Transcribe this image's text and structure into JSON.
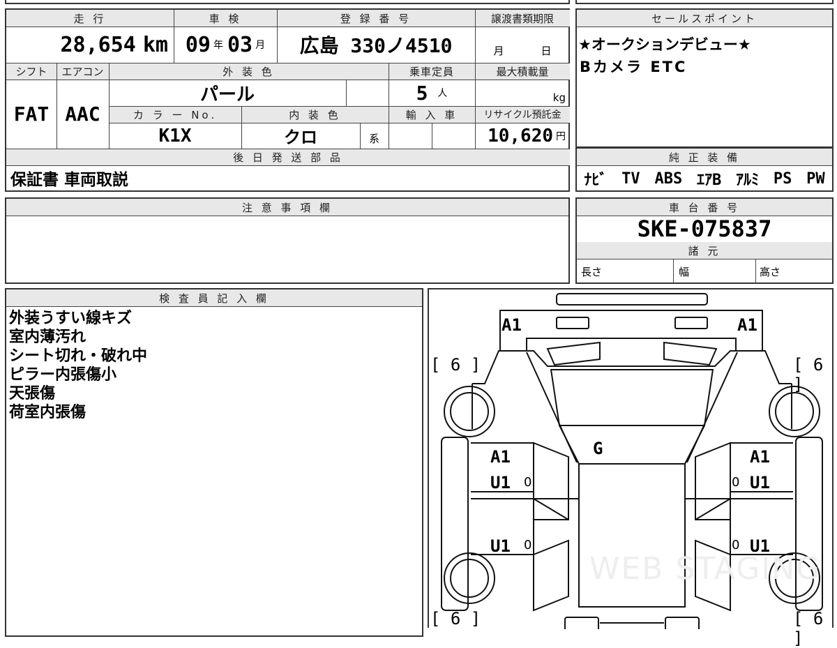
{
  "mileage": {
    "label": "走 行",
    "value": "28,654",
    "unit": "km"
  },
  "inspection": {
    "label": "車 検",
    "year": "09",
    "year_unit": "年",
    "month": "03",
    "month_unit": "月"
  },
  "registration": {
    "label": "登 録 番 号",
    "value": "広島 330ノ4510"
  },
  "transfer_deadline": {
    "label": "譲渡書類期限",
    "month_unit": "月",
    "day_unit": "日"
  },
  "shift": {
    "label": "シフト",
    "value": "FAT"
  },
  "aircon": {
    "label": "エアコン",
    "value": "AAC"
  },
  "exterior_color": {
    "label": "外 装 色",
    "value": "パール"
  },
  "capacity": {
    "label": "乗車定員",
    "value": "5",
    "unit": "人"
  },
  "max_load": {
    "label": "最大積載量",
    "unit": "kg"
  },
  "color_no": {
    "label": "カ ラ ー No.",
    "value": "K1X"
  },
  "interior_color": {
    "label": "内 装 色",
    "value": "クロ",
    "suffix": "系"
  },
  "import": {
    "label": "輸 入 車"
  },
  "recycle": {
    "label": "リサイクル預託金",
    "value": "10,620",
    "unit": "円"
  },
  "later_parts": {
    "label": "後 日 発 送 部 品",
    "value": "保証書 車両取説"
  },
  "sales_point": {
    "label": "セールスポイント",
    "lines": [
      "★オークションデビュー★",
      "Bカメラ ETC"
    ]
  },
  "equipment": {
    "label": "純 正 装 備",
    "items": [
      "ﾅﾋﾞ",
      "TV",
      "ABS",
      "ｴｱB",
      "ｱﾙﾐ",
      "PS",
      "PW"
    ]
  },
  "notes": {
    "label": "注 意 事 項 欄"
  },
  "chassis": {
    "label": "車 台 番 号",
    "value": "SKE-075837"
  },
  "specs": {
    "label": "諸 元",
    "length": "長さ",
    "width": "幅",
    "height": "高さ"
  },
  "inspector": {
    "label": "検 査 員 記 入 欄",
    "lines": [
      "外装うすい線キズ",
      "室内薄汚れ",
      "シート切れ・破れ中",
      "ピラー内張傷小",
      "天張傷",
      "荷室内張傷"
    ]
  },
  "diagram_marks": {
    "front_left": "A1",
    "front_right": "A1",
    "tire_fl": "[ 6 ]",
    "tire_fr": "[ 6 ]",
    "tire_rl": "[ 6 ]",
    "tire_rr": "[ 6 ]",
    "glass": "G",
    "door_fl_a": "A1",
    "door_fl_u": "U1",
    "door_fr_a": "A1",
    "door_fr_u": "U1",
    "door_rl_u": "U1",
    "door_rr_u": "U1",
    "zero": "0",
    "watermark": "WEB STAGING"
  }
}
